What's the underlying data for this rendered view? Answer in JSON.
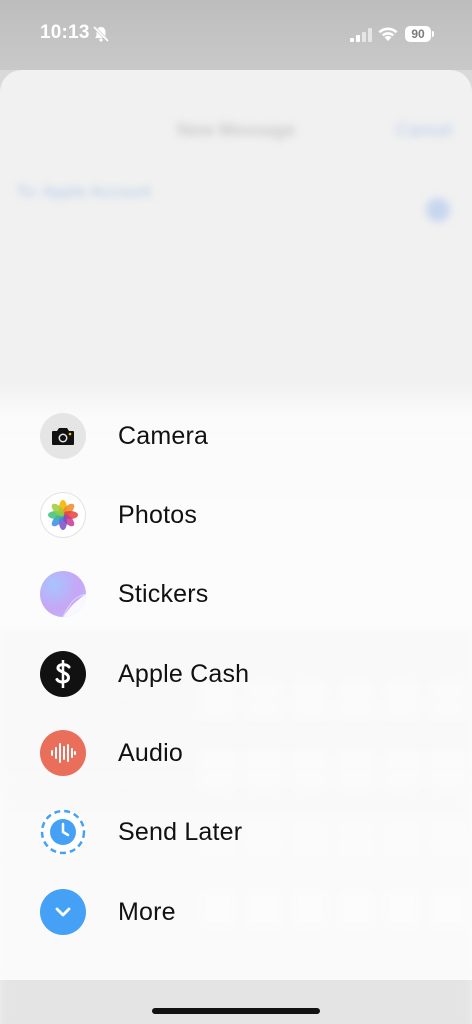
{
  "status_bar": {
    "time": "10:13",
    "battery": "90"
  },
  "sheet": {
    "title": "New Message",
    "cancel": "Cancel",
    "to_field": "To: Apple Account"
  },
  "menu": {
    "items": [
      {
        "label": "Camera",
        "icon": "camera-icon"
      },
      {
        "label": "Photos",
        "icon": "photos-icon"
      },
      {
        "label": "Stickers",
        "icon": "stickers-icon"
      },
      {
        "label": "Apple Cash",
        "icon": "apple-cash-icon"
      },
      {
        "label": "Audio",
        "icon": "audio-waveform-icon"
      },
      {
        "label": "Send Later",
        "icon": "send-later-clock-icon"
      },
      {
        "label": "More",
        "icon": "chevron-down-icon"
      }
    ]
  },
  "colors": {
    "audio": "#ea6f5a",
    "more": "#45a1f5",
    "send_later": "#45a1f5",
    "cash": "#111111"
  }
}
